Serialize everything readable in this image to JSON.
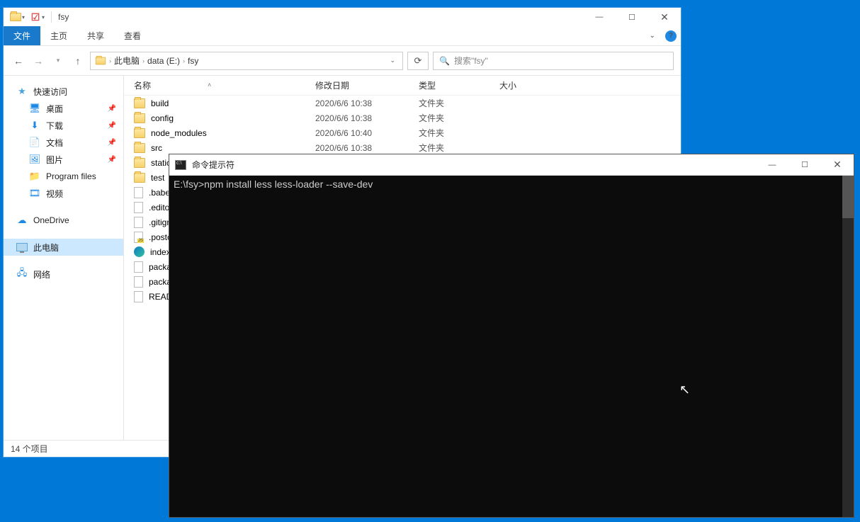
{
  "explorer": {
    "title": "fsy",
    "ribbon": {
      "file": "文件",
      "tabs": [
        "主页",
        "共享",
        "查看"
      ]
    },
    "breadcrumb": [
      "此电脑",
      "data (E:)",
      "fsy"
    ],
    "search_placeholder": "搜索\"fsy\"",
    "columns": {
      "name": "名称",
      "date": "修改日期",
      "type": "类型",
      "size": "大小"
    },
    "sidebar": {
      "quick": "快速访问",
      "quick_items": [
        {
          "icon": "desktop",
          "label": "桌面",
          "pinned": true
        },
        {
          "icon": "download",
          "label": "下载",
          "pinned": true
        },
        {
          "icon": "document",
          "label": "文档",
          "pinned": true
        },
        {
          "icon": "picture",
          "label": "图片",
          "pinned": true
        },
        {
          "icon": "folder",
          "label": "Program files",
          "pinned": false
        },
        {
          "icon": "video",
          "label": "视频",
          "pinned": false
        }
      ],
      "onedrive": "OneDrive",
      "thispc": "此电脑",
      "network": "网络"
    },
    "files": [
      {
        "icon": "folder",
        "name": "build",
        "date": "2020/6/6 10:38",
        "type": "文件夹"
      },
      {
        "icon": "folder",
        "name": "config",
        "date": "2020/6/6 10:38",
        "type": "文件夹"
      },
      {
        "icon": "folder",
        "name": "node_modules",
        "date": "2020/6/6 10:40",
        "type": "文件夹"
      },
      {
        "icon": "folder",
        "name": "src",
        "date": "2020/6/6 10:38",
        "type": "文件夹"
      },
      {
        "icon": "folder",
        "name": "static",
        "date": "",
        "type": ""
      },
      {
        "icon": "folder",
        "name": "test",
        "date": "",
        "type": ""
      },
      {
        "icon": "file",
        "name": ".babelrc",
        "date": "",
        "type": ""
      },
      {
        "icon": "file",
        "name": ".editorconfig",
        "date": "",
        "type": ""
      },
      {
        "icon": "file",
        "name": ".gitignore",
        "date": "",
        "type": ""
      },
      {
        "icon": "js",
        "name": ".postcssrc.js",
        "date": "",
        "type": ""
      },
      {
        "icon": "edge",
        "name": "index.html",
        "date": "",
        "type": ""
      },
      {
        "icon": "file",
        "name": "package.json",
        "date": "",
        "type": ""
      },
      {
        "icon": "file",
        "name": "package-lock.json",
        "date": "",
        "type": ""
      },
      {
        "icon": "file",
        "name": "README.md",
        "date": "",
        "type": ""
      }
    ],
    "status": "14 个项目"
  },
  "cmd": {
    "title": "命令提示符",
    "line": "E:\\fsy>npm install less less-loader --save-dev"
  }
}
